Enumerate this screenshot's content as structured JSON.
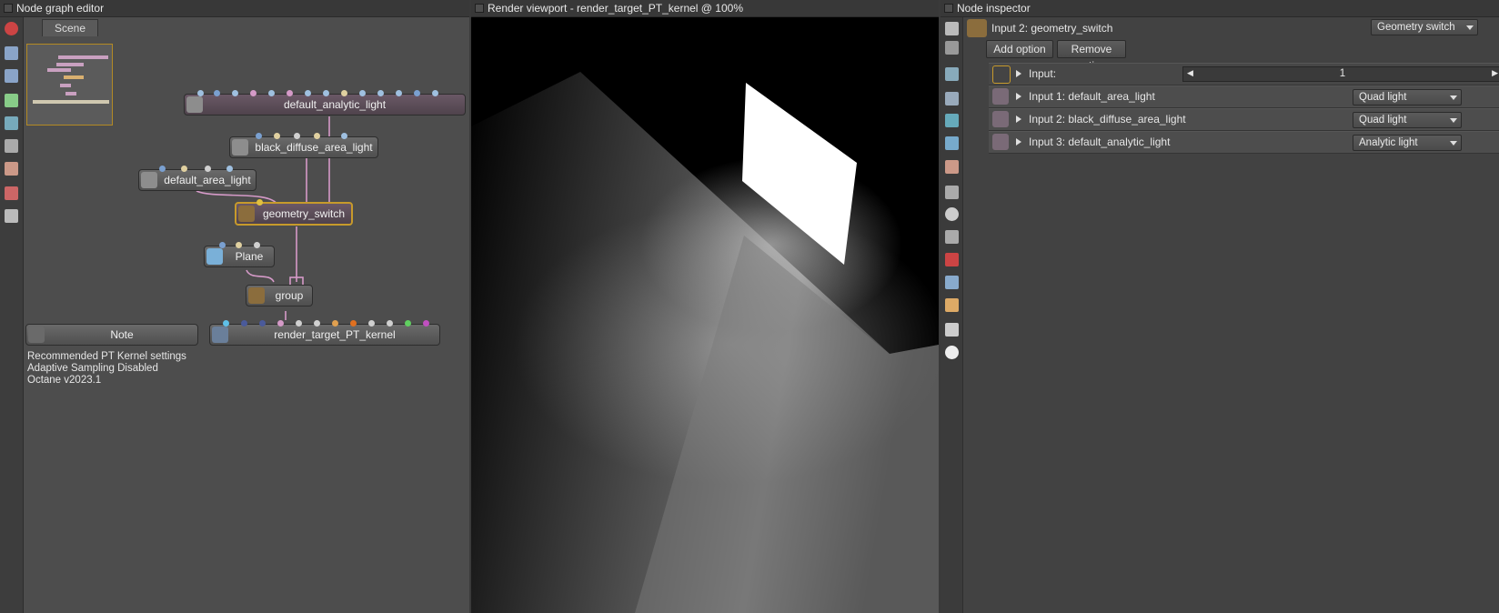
{
  "node_graph": {
    "title": "Node graph editor",
    "scene_tab": "Scene",
    "nodes": {
      "default_analytic_light": "default_analytic_light",
      "black_diffuse_area_light": "black_diffuse_area_light",
      "default_area_light": "default_area_light",
      "geometry_switch": "geometry_switch",
      "plane": "Plane",
      "group": "group",
      "render_target": "render_target_PT_kernel",
      "note": "Note"
    },
    "note_lines": [
      "Recommended PT Kernel settings",
      "Adaptive Sampling Disabled",
      "Octane v2023.1"
    ]
  },
  "viewport": {
    "title": "Render viewport - render_target_PT_kernel @ 100%"
  },
  "inspector": {
    "title": "Node inspector",
    "header_label": "Input 2: geometry_switch",
    "header_type": "Geometry switch",
    "add_option": "Add option",
    "remove_option": "Remove option",
    "input_row": {
      "label": "Input:",
      "value": "1"
    },
    "rows": [
      {
        "label": "Input 1: default_area_light",
        "type": "Quad light"
      },
      {
        "label": "Input 2: black_diffuse_area_light",
        "type": "Quad light"
      },
      {
        "label": "Input 3: default_analytic_light",
        "type": "Analytic light"
      }
    ]
  },
  "colors": {
    "selection": "#c79a2b",
    "wire": "#d59ac8",
    "node_body": "#5e4e5a"
  }
}
